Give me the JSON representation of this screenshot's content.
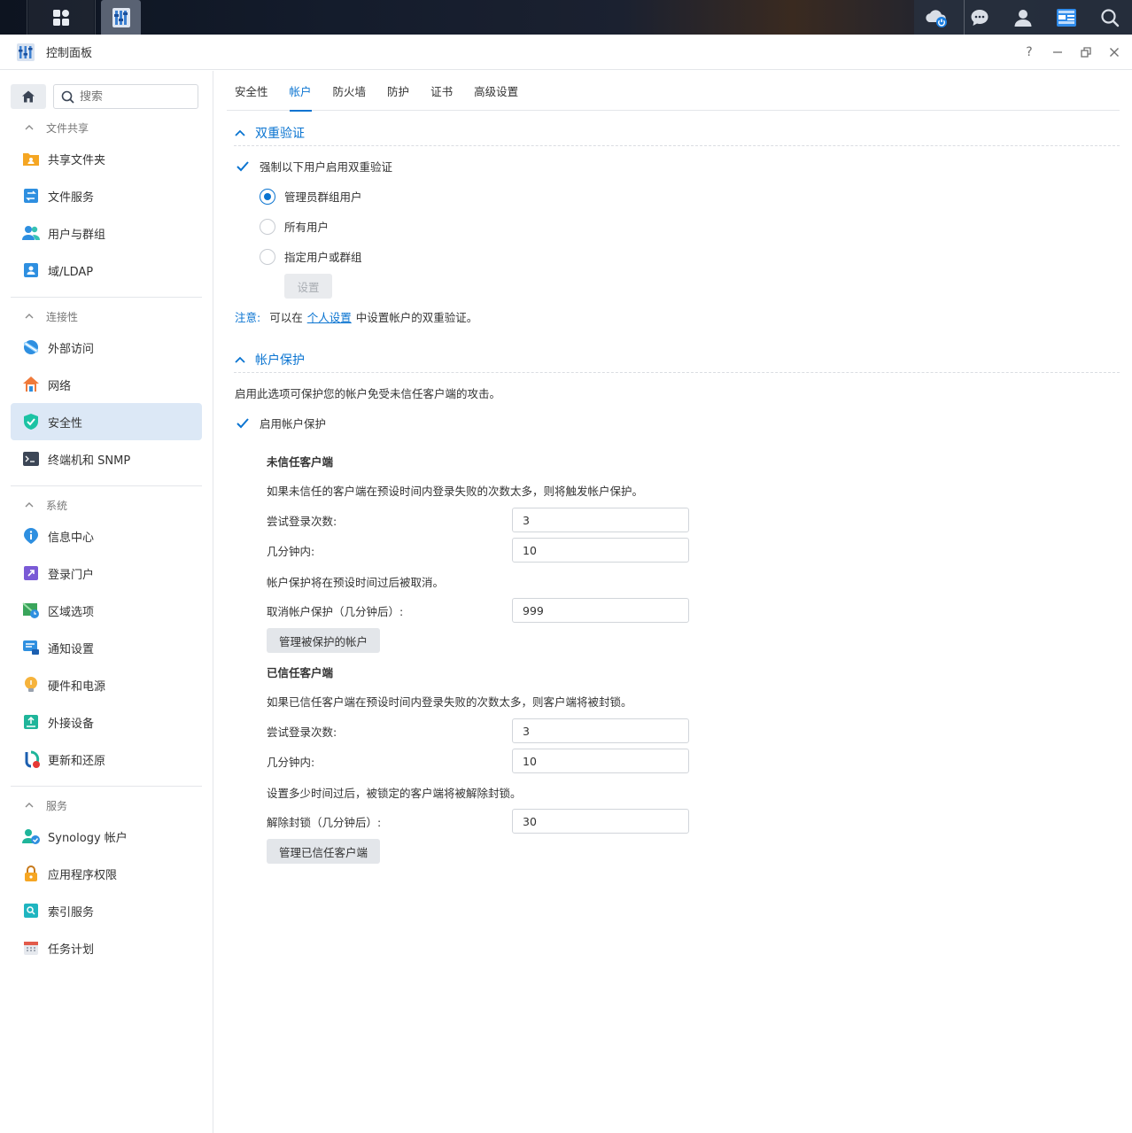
{
  "window": {
    "title": "控制面板"
  },
  "window_controls": {
    "help": "?",
    "minimize": "—",
    "close": "×"
  },
  "search": {
    "placeholder": "搜索"
  },
  "sidebar": {
    "groups": [
      {
        "label": "文件共享",
        "items": [
          "共享文件夹",
          "文件服务",
          "用户与群组",
          "域/LDAP"
        ]
      },
      {
        "label": "连接性",
        "items": [
          "外部访问",
          "网络",
          "安全性",
          "终端机和 SNMP"
        ]
      },
      {
        "label": "系统",
        "items": [
          "信息中心",
          "登录门户",
          "区域选项",
          "通知设置",
          "硬件和电源",
          "外接设备",
          "更新和还原"
        ]
      },
      {
        "label": "服务",
        "items": [
          "Synology 帐户",
          "应用程序权限",
          "索引服务",
          "任务计划"
        ]
      }
    ],
    "active_item": "安全性"
  },
  "tabs": [
    "安全性",
    "帐户",
    "防火墙",
    "防护",
    "证书",
    "高级设置"
  ],
  "active_tab": "帐户",
  "two_factor": {
    "title": "双重验证",
    "enforce_label": "强制以下用户启用双重验证",
    "enforce_checked": true,
    "options": [
      "管理员群组用户",
      "所有用户",
      "指定用户或群组"
    ],
    "selected_option": "管理员群组用户",
    "settings_button": "设置",
    "note_label": "注意:",
    "note_before": "可以在",
    "note_link": "个人设置",
    "note_after": "中设置帐户的双重验证。"
  },
  "account_protection": {
    "title": "帐户保护",
    "description": "启用此选项可保护您的帐户免受未信任客户端的攻击。",
    "enable_label": "启用帐户保护",
    "enable_checked": true,
    "untrusted": {
      "title": "未信任客户端",
      "description": "如果未信任的客户端在预设时间内登录失败的次数太多，则将触发帐户保护。",
      "attempts_label": "尝试登录次数:",
      "attempts_value": "3",
      "minutes_label": "几分钟内:",
      "minutes_value": "10",
      "cancel_desc": "帐户保护将在预设时间过后被取消。",
      "cancel_label": "取消帐户保护（几分钟后）:",
      "cancel_value": "999",
      "manage_button": "管理被保护的帐户"
    },
    "trusted": {
      "title": "已信任客户端",
      "description": "如果已信任客户端在预设时间内登录失败的次数太多，则客户端将被封锁。",
      "attempts_label": "尝试登录次数:",
      "attempts_value": "3",
      "minutes_label": "几分钟内:",
      "minutes_value": "10",
      "unblock_desc": "设置多少时间过后，被锁定的客户端将被解除封锁。",
      "unblock_label": "解除封锁（几分钟后）:",
      "unblock_value": "30",
      "manage_button": "管理已信任客户端"
    }
  },
  "colors": {
    "accent": "#0a74d1",
    "active_bg": "#dce8f6"
  }
}
